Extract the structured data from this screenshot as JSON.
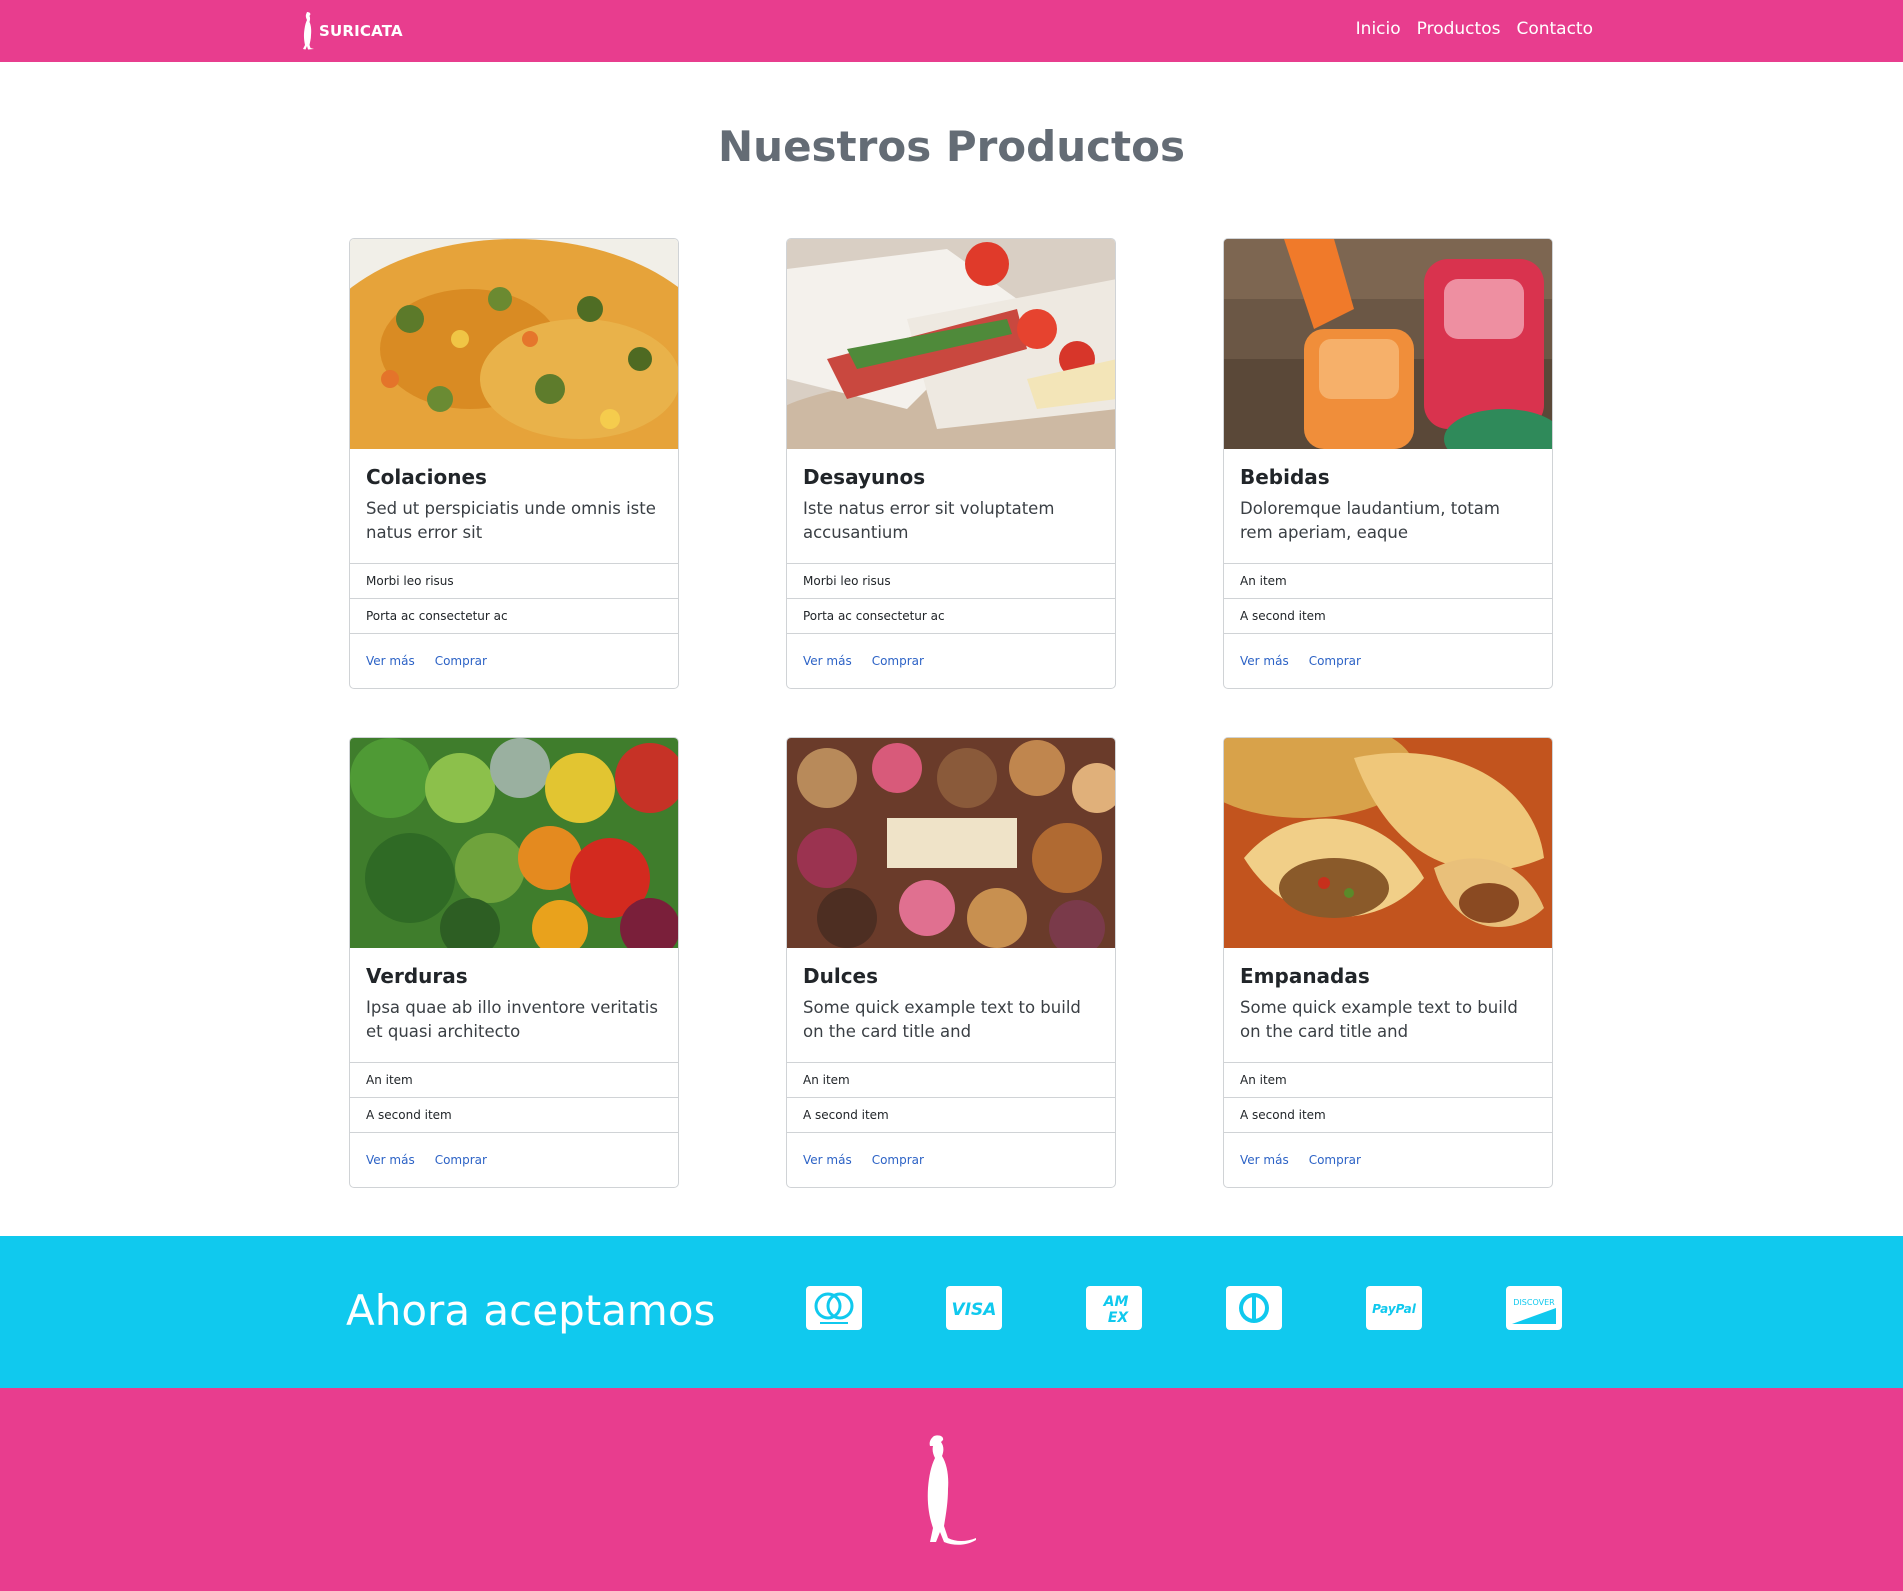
{
  "brand": {
    "name": "SURICATA"
  },
  "nav": {
    "items": [
      {
        "label": "Inicio"
      },
      {
        "label": "Productos"
      },
      {
        "label": "Contacto"
      }
    ]
  },
  "products_section": {
    "title": "Nuestros Productos",
    "cards": [
      {
        "title": "Colaciones",
        "text": "Sed ut perspiciatis unde omnis iste natus error sit",
        "items": [
          "Morbi leo risus",
          "Porta ac consectetur ac"
        ],
        "links": [
          "Ver más",
          "Comprar"
        ]
      },
      {
        "title": "Desayunos",
        "text": "Iste natus error sit voluptatem accusantium",
        "items": [
          "Morbi leo risus",
          "Porta ac consectetur ac"
        ],
        "links": [
          "Ver más",
          "Comprar"
        ]
      },
      {
        "title": "Bebidas",
        "text": "Doloremque laudantium, totam rem aperiam, eaque",
        "items": [
          "An item",
          "A second item"
        ],
        "links": [
          "Ver más",
          "Comprar"
        ]
      },
      {
        "title": "Verduras",
        "text": "Ipsa quae ab illo inventore veritatis et quasi architecto",
        "items": [
          "An item",
          "A second item"
        ],
        "links": [
          "Ver más",
          "Comprar"
        ]
      },
      {
        "title": "Dulces",
        "text": "Some quick example text to build on the card title and",
        "items": [
          "An item",
          "A second item"
        ],
        "links": [
          "Ver más",
          "Comprar"
        ]
      },
      {
        "title": "Empanadas",
        "text": "Some quick example text to build on the card title and",
        "items": [
          "An item",
          "A second item"
        ],
        "links": [
          "Ver más",
          "Comprar"
        ]
      }
    ]
  },
  "payments": {
    "title": "Ahora aceptamos",
    "icons": [
      "mastercard-icon",
      "visa-icon",
      "amex-icon",
      "diners-icon",
      "paypal-icon",
      "discover-icon"
    ],
    "labels": {
      "visa": "VISA",
      "amex_top": "AM",
      "amex_bottom": "EX",
      "paypal": "PayPal",
      "discover": "DISCOVER"
    }
  },
  "colors": {
    "primary": "#e83d8e",
    "accent": "#10c9ee",
    "link": "#2d63c6",
    "title_gray": "#646c75"
  }
}
